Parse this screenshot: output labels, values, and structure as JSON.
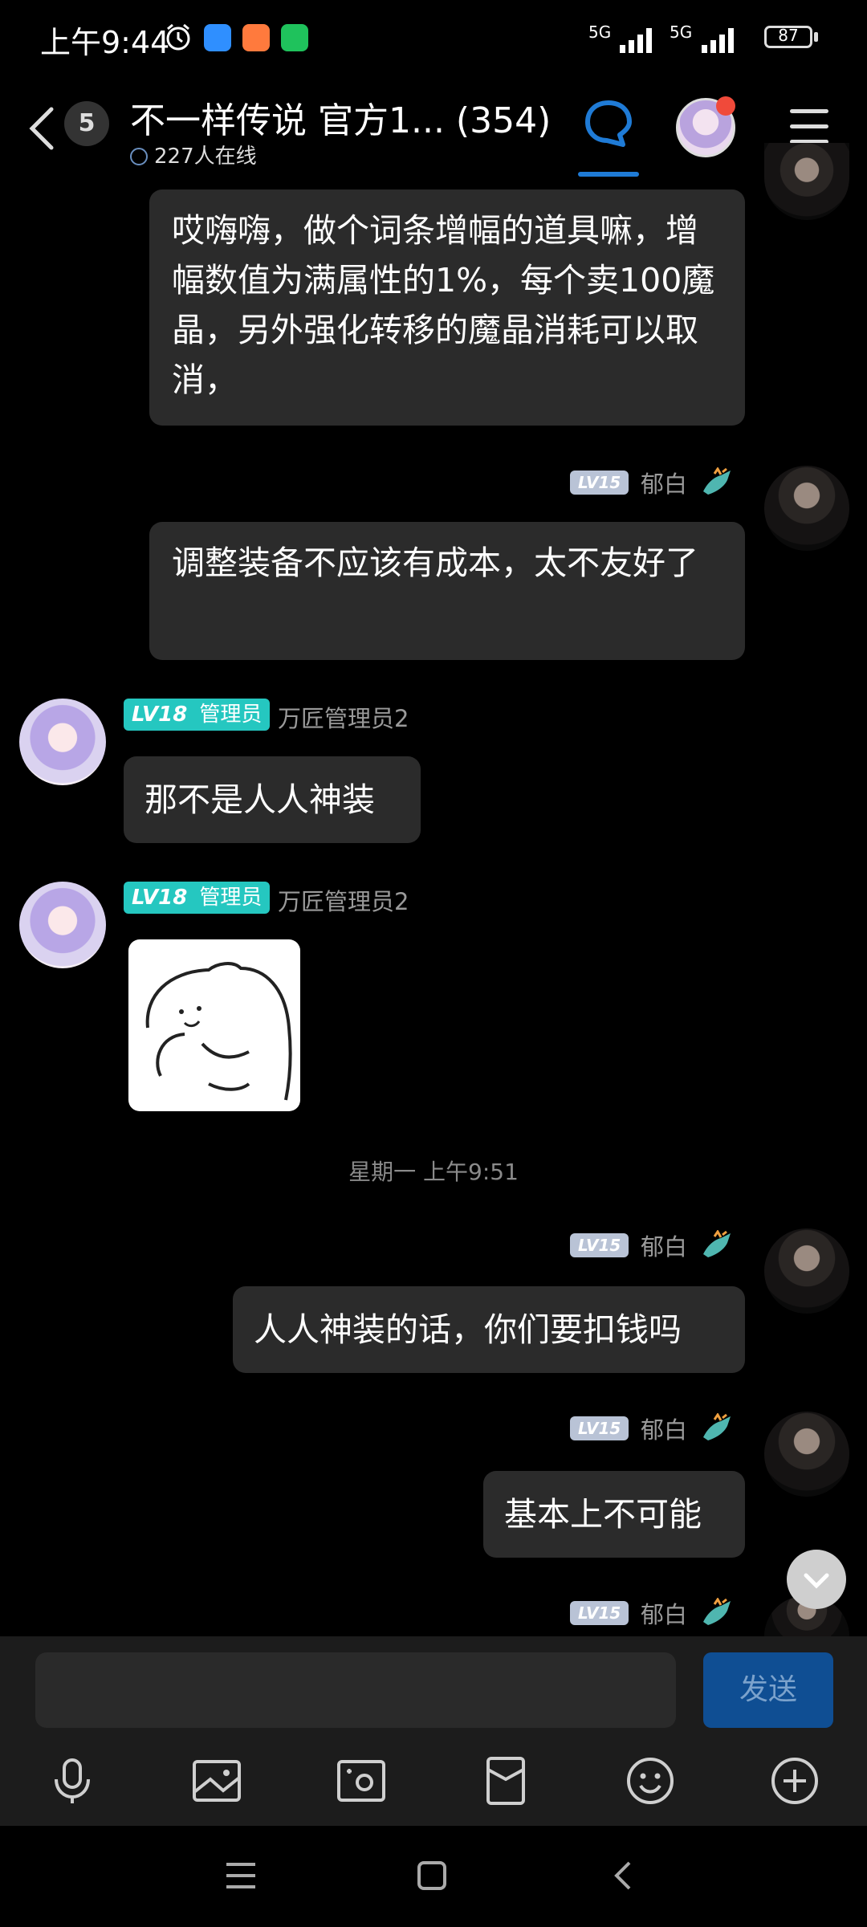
{
  "status_bar": {
    "time": "上午9:44",
    "network_label_1": "5G",
    "network_label_2": "5G",
    "battery": "87"
  },
  "header": {
    "unread_count": "5",
    "group_title": "不一样传说 官方1... (354)",
    "online_text": "227人在线"
  },
  "messages": [
    {
      "side": "right",
      "text": "哎嗨嗨，做个词条增幅的道具嘛，增幅数值为满属性的1%，每个卖100魔晶，另外强化转移的魔晶消耗可以取消，"
    },
    {
      "side": "right",
      "level": "LV15",
      "sender": "郁白",
      "text": "调整装备不应该有成本，太不友好了"
    },
    {
      "side": "left",
      "level": "LV18",
      "role": "管理员",
      "sender": "万匠管理员2",
      "text": "那不是人人神装"
    },
    {
      "side": "left",
      "level": "LV18",
      "role": "管理员",
      "sender": "万匠管理员2",
      "sticker": true
    },
    {
      "timestamp": "星期一 上午9:51"
    },
    {
      "side": "right",
      "level": "LV15",
      "sender": "郁白",
      "text": "人人神装的话，你们要扣钱吗"
    },
    {
      "side": "right",
      "level": "LV15",
      "sender": "郁白",
      "text": "基本上不可能"
    },
    {
      "side": "right",
      "level": "LV15",
      "sender": "郁白"
    }
  ],
  "input": {
    "placeholder": "",
    "send_label": "发送"
  },
  "toolbar": [
    "microphone-icon",
    "image-icon",
    "camera-icon",
    "red-packet-icon",
    "emoji-icon",
    "plus-icon"
  ],
  "colors": {
    "background": "#000000",
    "bubble": "#2b2b2b",
    "accent": "#1f7bd6",
    "admin_badge": "#25c7c0",
    "send_button": "#0f4e93"
  }
}
